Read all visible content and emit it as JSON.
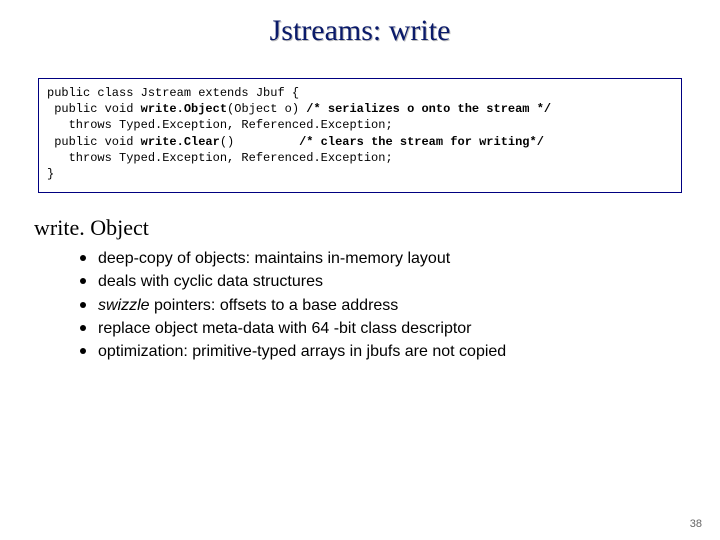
{
  "title": "Jstreams: write",
  "code": {
    "l1a": "public class Jstream extends Jbuf {",
    "l2a": " public void ",
    "l2b": "write.Object",
    "l2c": "(Object o) ",
    "l2d": "/* serializes o onto the stream */",
    "l3a": "   throws Typed.Exception, Referenced.Exception;",
    "l4a": " public void ",
    "l4b": "write.Clear",
    "l4c": "()         ",
    "l4d": "/* clears the stream for writing*/",
    "l5a": "   throws Typed.Exception, Referenced.Exception;",
    "l6a": "}"
  },
  "section": "write. Object",
  "bullets": {
    "b1": "deep-copy of objects: maintains in-memory layout",
    "b2": "deals with cyclic data structures",
    "b3_i": "swizzle",
    "b3_r": " pointers: offsets to a base address",
    "b4": "replace object meta-data with 64 -bit class descriptor",
    "b5": "optimization: primitive-typed arrays in jbufs are not copied"
  },
  "pagenum": "38"
}
